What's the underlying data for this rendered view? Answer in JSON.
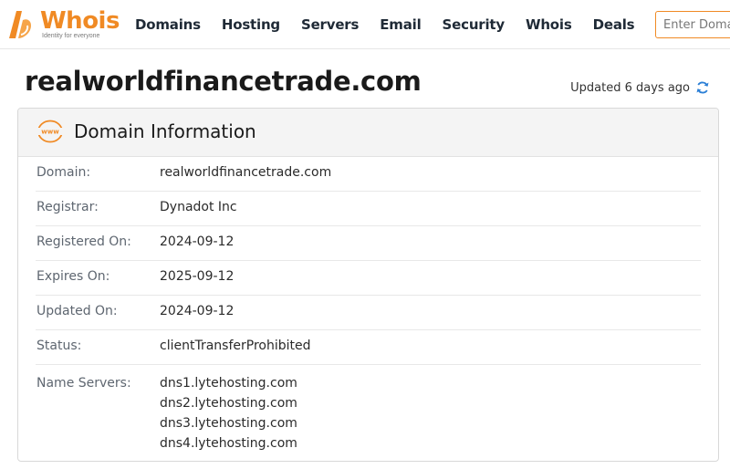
{
  "brand": {
    "name": "Whois",
    "tagline": "Identity for everyone",
    "accent": "#f08a24"
  },
  "nav": {
    "items": [
      "Domains",
      "Hosting",
      "Servers",
      "Email",
      "Security",
      "Whois",
      "Deals"
    ]
  },
  "search": {
    "placeholder": "Enter Domain"
  },
  "page": {
    "title": "realworldfinancetrade.com",
    "updated": "Updated 6 days ago"
  },
  "card": {
    "title": "Domain Information",
    "icon": "www-icon",
    "rows": [
      {
        "label": "Domain:",
        "value": "realworldfinancetrade.com"
      },
      {
        "label": "Registrar:",
        "value": "Dynadot Inc"
      },
      {
        "label": "Registered On:",
        "value": "2024-09-12"
      },
      {
        "label": "Expires On:",
        "value": "2025-09-12"
      },
      {
        "label": "Updated On:",
        "value": "2024-09-12"
      },
      {
        "label": "Status:",
        "value": "clientTransferProhibited"
      }
    ],
    "name_servers": {
      "label": "Name Servers:",
      "values": [
        "dns1.lytehosting.com",
        "dns2.lytehosting.com",
        "dns3.lytehosting.com",
        "dns4.lytehosting.com"
      ]
    }
  }
}
